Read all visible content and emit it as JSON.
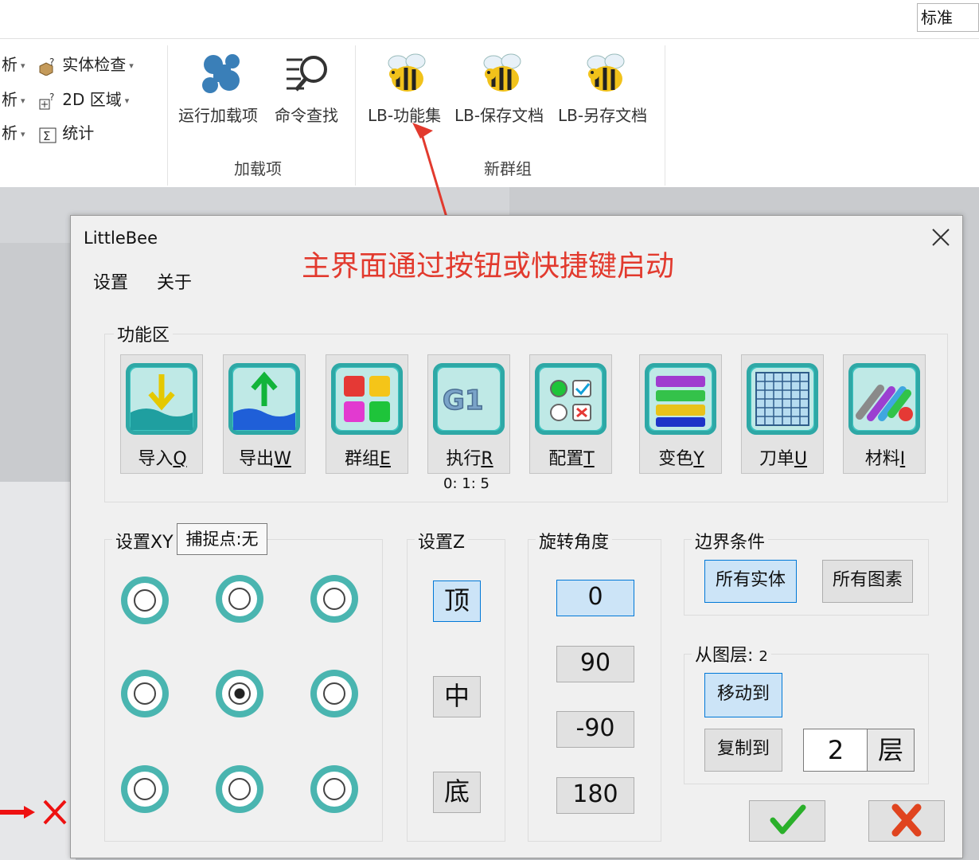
{
  "ribbon": {
    "style_box": "标准",
    "left_col": [
      {
        "prefix": "析",
        "icon": "solid-check-icon",
        "label": "实体检查"
      },
      {
        "prefix": "析",
        "icon": "2d-region-icon",
        "label": "2D 区域"
      },
      {
        "prefix": "析",
        "icon": "sigma-icon",
        "label": "统计"
      }
    ],
    "addins": {
      "run": "运行加载项",
      "find": "命令查找",
      "group": "加载项"
    },
    "newgroup": {
      "buttons": [
        "LB-功能集",
        "LB-保存文档",
        "LB-另存文档"
      ],
      "group": "新群组"
    }
  },
  "dialog": {
    "title": "LittleBee",
    "annotation": "主界面通过按钮或快捷键启动",
    "menu": [
      "设置",
      "关于"
    ],
    "func_area": {
      "label": "功能区",
      "tiles": [
        {
          "label": "导入",
          "key": "Q"
        },
        {
          "label": "导出",
          "key": "W"
        },
        {
          "label": "群组",
          "key": "E"
        },
        {
          "label": "执行",
          "key": "R"
        },
        {
          "label": "配置",
          "key": "T"
        },
        {
          "label": "变色",
          "key": "Y"
        },
        {
          "label": "刀单",
          "key": "U"
        },
        {
          "label": "材料",
          "key": "I"
        }
      ],
      "exec_timer": "0: 1: 5",
      "g1_text": "G1"
    },
    "set_xy": {
      "label": "设置XY",
      "snap": "捕捉点:无",
      "selected": 4
    },
    "set_z": {
      "label": "设置Z",
      "options": [
        "顶",
        "中",
        "底"
      ],
      "selected": 0
    },
    "rotation": {
      "label": "旋转角度",
      "options": [
        "0",
        "90",
        "-90",
        "180"
      ],
      "selected": 0
    },
    "boundary": {
      "label": "边界条件",
      "options": [
        "所有实体",
        "所有图素"
      ],
      "selected": 0
    },
    "layer": {
      "label": "从图层:",
      "value": "2",
      "move_to": "移动到",
      "copy_to": "复制到",
      "input": "2",
      "unit": "层"
    }
  }
}
